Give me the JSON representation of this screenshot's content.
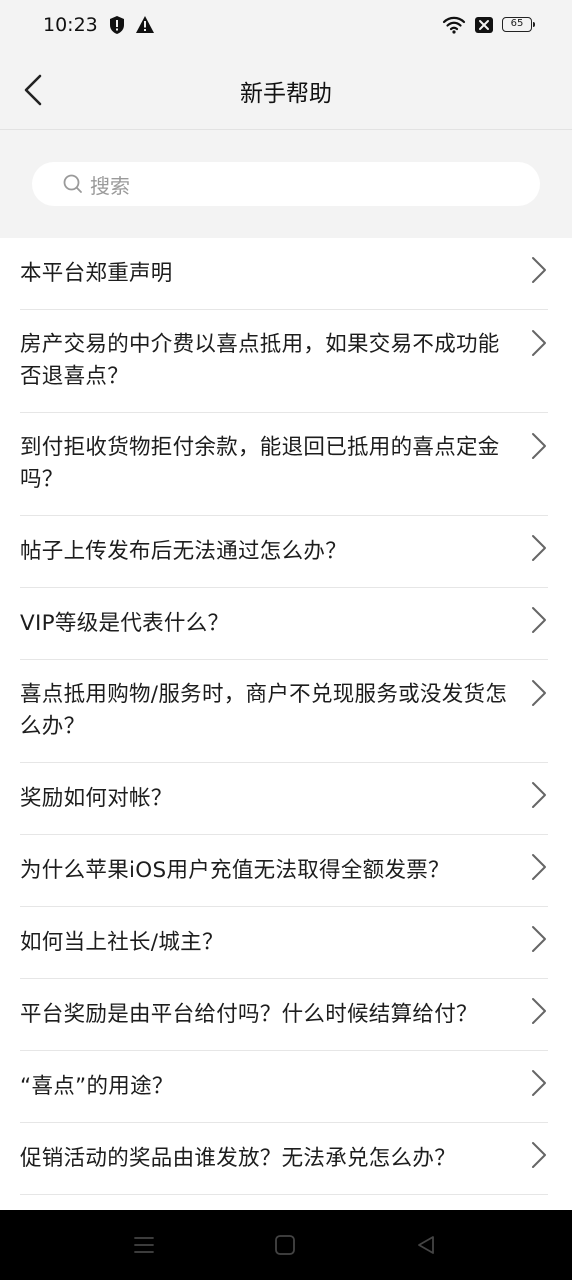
{
  "status_bar": {
    "time": "10:23",
    "left_icons": [
      "shield-alert-icon",
      "warning-icon"
    ],
    "right_icons": [
      "wifi-icon",
      "sim-off-icon",
      "battery-icon"
    ],
    "battery_level": "65"
  },
  "header": {
    "back_icon": "chevron-left-icon",
    "title": "新手帮助"
  },
  "search": {
    "icon": "search-icon",
    "placeholder": "搜索"
  },
  "faq_items": [
    {
      "label": "本平台郑重声明"
    },
    {
      "label": "房产交易的中介费以喜点抵用，如果交易不成功能否退喜点？"
    },
    {
      "label": "到付拒收货物拒付余款，能退回已抵用的喜点定金吗？"
    },
    {
      "label": "帖子上传发布后无法通过怎么办？"
    },
    {
      "label": "VIP等级是代表什么？"
    },
    {
      "label": "喜点抵用购物/服务时，商户不兑现服务或没发货怎么办？"
    },
    {
      "label": "奖励如何对帐？"
    },
    {
      "label": "为什么苹果iOS用户充值无法取得全额发票？"
    },
    {
      "label": "如何当上社长/城主？"
    },
    {
      "label": "平台奖励是由平台给付吗？什么时候结算给付？"
    },
    {
      "label": "“喜点”的用途？"
    },
    {
      "label": "促销活动的奖品由谁发放？无法承兑怎么办？"
    }
  ],
  "system_nav": {
    "icons": [
      "menu-icon",
      "home-icon",
      "back-triangle-icon"
    ]
  },
  "colors": {
    "background": "#f3f3f3",
    "list_background": "#ffffff",
    "divider": "#e6e6e6",
    "text": "#1d1d1d",
    "placeholder": "#9a9a9a",
    "system_nav": "#000000"
  }
}
